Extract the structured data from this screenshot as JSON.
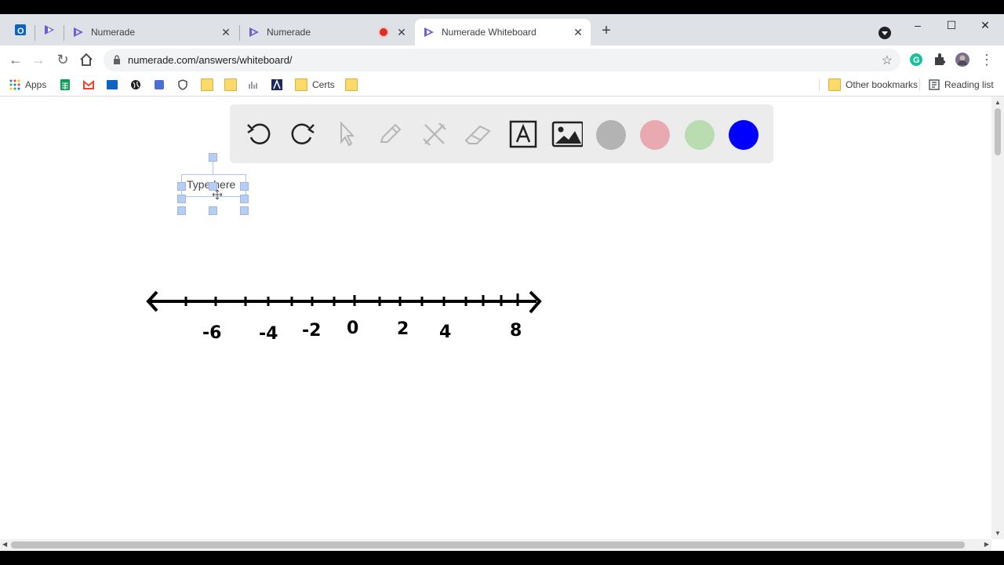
{
  "browser": {
    "tabs": [
      {
        "title": "Numerade",
        "close": "✕"
      },
      {
        "title": "Numerade",
        "close": "✕"
      },
      {
        "title": "Numerade Whiteboard",
        "close": "✕"
      }
    ],
    "new_tab": "+",
    "url": "numerade.com/answers/whiteboard/",
    "window_controls": [
      "–",
      "☐",
      "✕"
    ]
  },
  "bookmarks": {
    "apps": "Apps",
    "certs": "Certs",
    "other": "Other bookmarks",
    "reading": "Reading list"
  },
  "whiteboard": {
    "tools": [
      "undo-icon",
      "redo-icon",
      "pointer-icon",
      "pen-icon",
      "tools-icon",
      "eraser-icon",
      "text-tool-icon",
      "image-icon"
    ],
    "colors": [
      "#b3b3b3",
      "#e8aab0",
      "#b9dcb0",
      "#0000ff"
    ],
    "textbox": "Type here",
    "number_line": {
      "labels": [
        "-6",
        "-4",
        "-2",
        "0",
        "2",
        "4",
        "8"
      ]
    }
  }
}
